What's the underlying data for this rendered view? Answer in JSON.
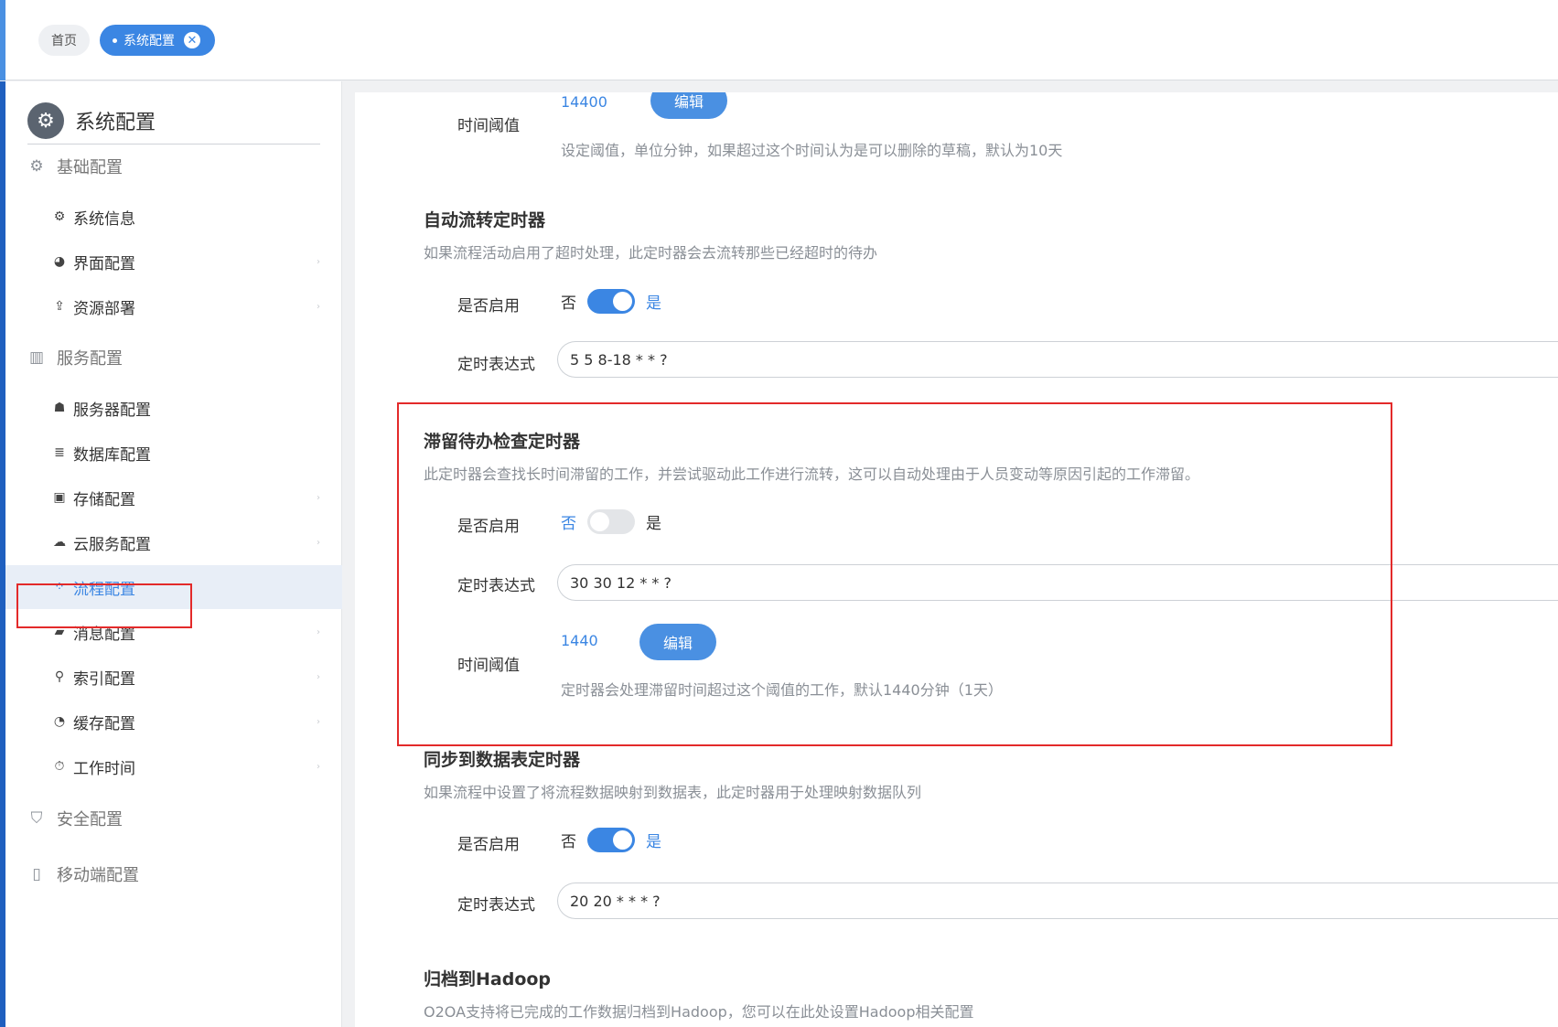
{
  "tabs": {
    "home": "首页",
    "active": "系统配置",
    "close_glyph": "✕"
  },
  "sidebar": {
    "title": "系统配置",
    "groups": [
      {
        "label": "基础配置",
        "icon": "gear-icon",
        "items": [
          {
            "label": "系统信息",
            "icon": "gear-icon"
          },
          {
            "label": "界面配置",
            "icon": "palette-icon"
          },
          {
            "label": "资源部署",
            "icon": "upload-icon"
          }
        ]
      },
      {
        "label": "服务配置",
        "icon": "server-icon",
        "items": [
          {
            "label": "服务器配置",
            "icon": "server-user-icon"
          },
          {
            "label": "数据库配置",
            "icon": "database-icon"
          },
          {
            "label": "存储配置",
            "icon": "storage-icon"
          },
          {
            "label": "云服务配置",
            "icon": "cloud-icon"
          },
          {
            "label": "流程配置",
            "icon": "flow-icon",
            "active": true
          },
          {
            "label": "消息配置",
            "icon": "message-icon"
          },
          {
            "label": "索引配置",
            "icon": "search-icon"
          },
          {
            "label": "缓存配置",
            "icon": "pie-icon"
          },
          {
            "label": "工作时间",
            "icon": "stopwatch-icon"
          }
        ]
      },
      {
        "label": "安全配置",
        "icon": "shield-icon",
        "items": []
      },
      {
        "label": "移动端配置",
        "icon": "mobile-icon",
        "items": []
      }
    ]
  },
  "content": {
    "draft_threshold": {
      "label": "时间阈值",
      "value": "14400",
      "edit_label": "编辑",
      "hint": "设定阈值，单位分钟，如果超过这个时间认为是可以删除的草稿，默认为10天"
    },
    "auto_flow": {
      "title": "自动流转定时器",
      "desc": "如果流程活动启用了超时处理，此定时器会去流转那些已经超时的待办",
      "enable_label": "是否启用",
      "off": "否",
      "on": "是",
      "enabled": true,
      "cron_label": "定时表达式",
      "cron": "5 5 8-18 * * ?"
    },
    "stranded": {
      "title": "滞留待办检查定时器",
      "desc": "此定时器会查找长时间滞留的工作，并尝试驱动此工作进行流转，这可以自动处理由于人员变动等原因引起的工作滞留。",
      "enable_label": "是否启用",
      "off": "否",
      "on": "是",
      "enabled": false,
      "cron_label": "定时表达式",
      "cron": "30 30 12 * * ?",
      "threshold_label": "时间阈值",
      "threshold": "1440",
      "edit_label": "编辑",
      "hint": "定时器会处理滞留时间超过这个阈值的工作，默认1440分钟（1天）"
    },
    "sync_table": {
      "title": "同步到数据表定时器",
      "desc": "如果流程中设置了将流程数据映射到数据表，此定时器用于处理映射数据队列",
      "enable_label": "是否启用",
      "off": "否",
      "on": "是",
      "enabled": true,
      "cron_label": "定时表达式",
      "cron": "20 20 * * * ?"
    },
    "hadoop": {
      "title": "归档到Hadoop",
      "desc": "O2OA支持将已完成的工作数据归档到Hadoop，您可以在此处设置Hadoop相关配置"
    }
  },
  "colors": {
    "accent": "#3b86e3",
    "highlight_box": "#e32a2a",
    "muted_text": "#8a8f96"
  }
}
